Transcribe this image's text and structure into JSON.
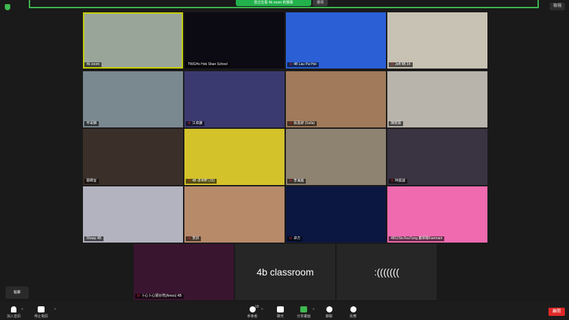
{
  "window": {
    "share_banner": "您正在看 4b zoom 的螢幕",
    "banner_options": "選項",
    "view_button": "檢視"
  },
  "tiles": [
    {
      "name": "4b zoom",
      "muted": false,
      "active": true,
      "color": "#9aa59a"
    },
    {
      "name": "TWGHs Hok Shan School",
      "muted": false,
      "active": false,
      "color": "#0c0a12"
    },
    {
      "name": "4B Lau Pui Hei",
      "muted": true,
      "active": false,
      "color": "#2b5fd6"
    },
    {
      "name": "Jeff 4B 14",
      "muted": true,
      "active": false,
      "color": "#c8c2b4"
    },
    {
      "name": "卒采錦",
      "muted": false,
      "active": false,
      "color": "#7a8890"
    },
    {
      "name": "江卓謙",
      "muted": true,
      "active": false,
      "color": "#3b3a70"
    },
    {
      "name": "張嘉諺 (Sulla)",
      "muted": true,
      "active": false,
      "color": "#a07a5a"
    },
    {
      "name": "陳賀霖",
      "muted": false,
      "active": false,
      "color": "#b9b4ab"
    },
    {
      "name": "鄭卿宜",
      "muted": false,
      "active": false,
      "color": "#3b2f2a"
    },
    {
      "name": "4B 卓世軒 (15)",
      "muted": true,
      "active": false,
      "color": "#d4c22a"
    },
    {
      "name": "李海嵐",
      "muted": true,
      "active": false,
      "color": "#8e8270"
    },
    {
      "name": "阿賓誠",
      "muted": true,
      "active": false,
      "color": "#3a3342"
    },
    {
      "name": "Shaay 4B",
      "muted": false,
      "active": false,
      "color": "#b3b3c0"
    },
    {
      "name": "李詩",
      "muted": true,
      "active": false,
      "color": "#b78a6a"
    },
    {
      "name": "卓方",
      "muted": true,
      "active": false,
      "color": "#0b1740"
    },
    {
      "name": "4B12SiuTsuiTung 蕭翠瞳Kanmani",
      "muted": false,
      "active": false,
      "color": "#f06ab0"
    },
    {
      "name": "卜心卜心梁炒然(Amos) 4B",
      "muted": true,
      "active": false,
      "color": "#3a1530"
    },
    {
      "name": "",
      "big_text": "4b classroom",
      "muted": false,
      "active": false,
      "color": "#262626"
    },
    {
      "name": "",
      "big_text": ":(((((((",
      "muted": false,
      "active": false,
      "color": "#262626"
    }
  ],
  "tooltip": "點擊",
  "toolbar": {
    "join_audio": "加入音訊",
    "stop_video": "停止視訊",
    "participants": "參會者",
    "participants_count": "19",
    "chat": "聊天",
    "share_screen": "分享畫面",
    "record": "錄製",
    "reactions": "反應",
    "end": "離開"
  },
  "colors": {
    "accent_green": "#3fb950",
    "active_outline": "#c8d000",
    "end_red": "#e02828"
  }
}
